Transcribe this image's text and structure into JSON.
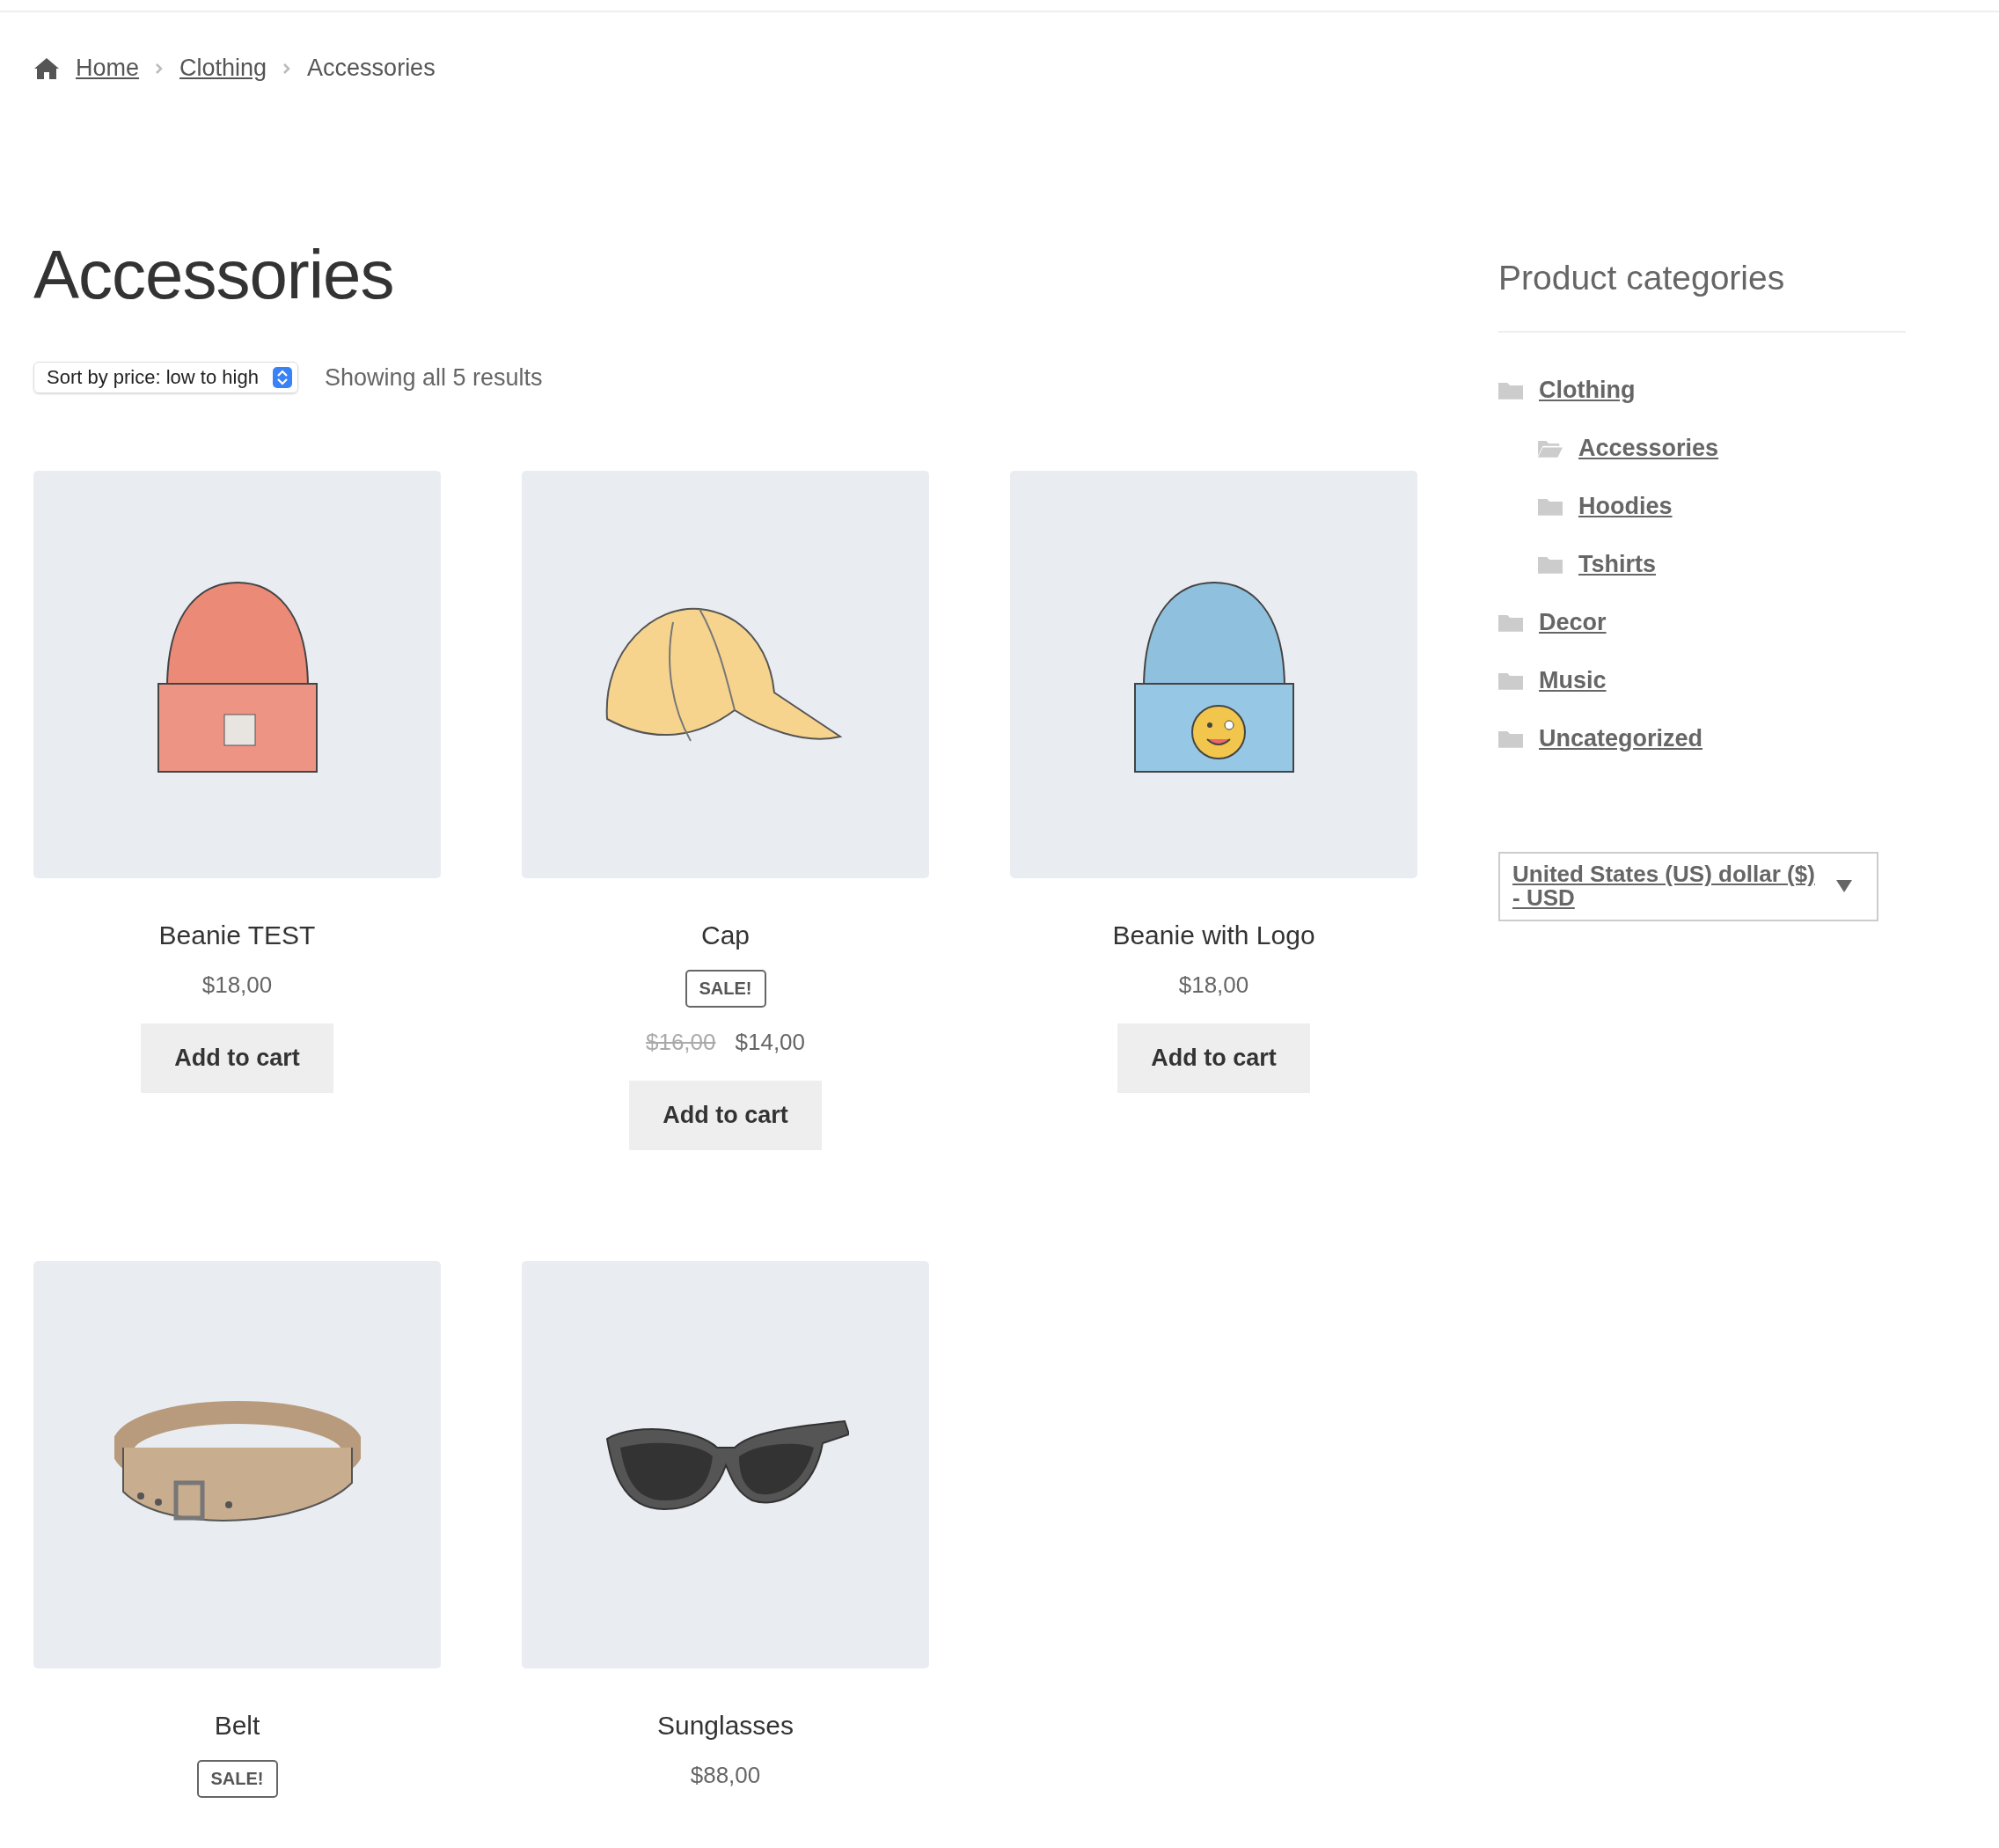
{
  "breadcrumb": [
    {
      "label": "Home",
      "link": true
    },
    {
      "label": "Clothing",
      "link": true
    },
    {
      "label": "Accessories",
      "link": false
    }
  ],
  "page_title": "Accessories",
  "sort": {
    "value": "Sort by price: low to high"
  },
  "result_count": "Showing all 5 results",
  "products": [
    {
      "kind": "beanie",
      "name": "Beanie TEST",
      "price": "$18,00",
      "button": "Add to cart"
    },
    {
      "kind": "cap",
      "name": "Cap",
      "sale_badge": "SALE!",
      "old_price": "$16,00",
      "price": "$14,00",
      "button": "Add to cart"
    },
    {
      "kind": "beanie-logo",
      "name": "Beanie with Logo",
      "price": "$18,00",
      "button": "Add to cart"
    },
    {
      "kind": "belt",
      "name": "Belt",
      "sale_badge": "SALE!"
    },
    {
      "kind": "sunglasses",
      "name": "Sunglasses",
      "price": "$88,00"
    }
  ],
  "sidebar": {
    "title": "Product categories",
    "categories": [
      {
        "label": "Clothing",
        "current": false,
        "children": [
          {
            "label": "Accessories",
            "current": true
          },
          {
            "label": "Hoodies",
            "current": false
          },
          {
            "label": "Tshirts",
            "current": false
          }
        ]
      },
      {
        "label": "Decor",
        "current": false
      },
      {
        "label": "Music",
        "current": false
      },
      {
        "label": "Uncategorized",
        "current": false
      }
    ],
    "currency": {
      "value": "United States (US) dollar ($) - USD"
    }
  }
}
